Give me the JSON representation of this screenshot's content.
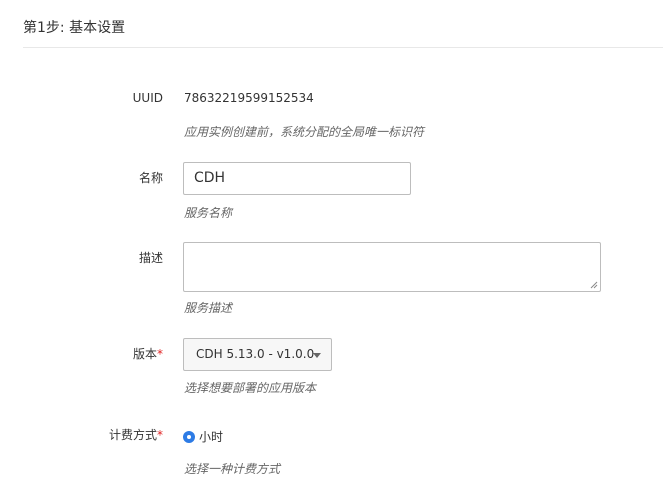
{
  "step": {
    "title": "第1步: 基本设置"
  },
  "uuid": {
    "label": "UUID",
    "value": "78632219599152534",
    "help": "应用实例创建前，系统分配的全局唯一标识符"
  },
  "name": {
    "label": "名称",
    "value": "CDH",
    "help": "服务名称"
  },
  "description": {
    "label": "描述",
    "value": "",
    "help": "服务描述"
  },
  "version": {
    "label": "版本",
    "required_mark": "*",
    "selected": "CDH 5.13.0 - v1.0.0",
    "help": "选择想要部署的应用版本"
  },
  "billing": {
    "label": "计费方式",
    "required_mark": "*",
    "selected_option": "小时",
    "help": "选择一种计费方式"
  },
  "colors": {
    "accent": "#2d7be5",
    "required": "#e02020",
    "border": "#bdbdbd"
  }
}
